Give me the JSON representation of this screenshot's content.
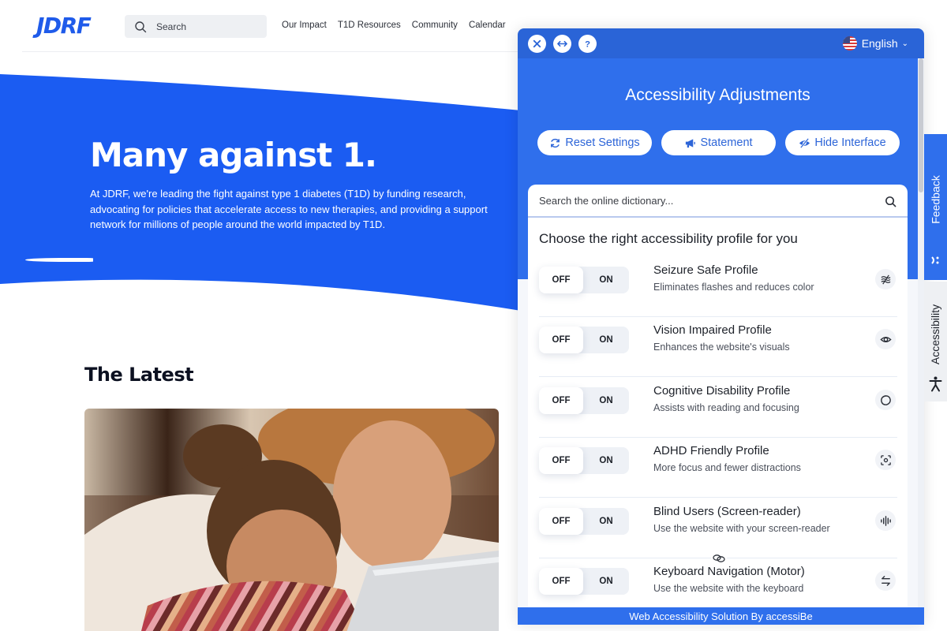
{
  "site": {
    "logo": "JDRF",
    "search_placeholder": "Search",
    "nav": [
      "Our Impact",
      "T1D Resources",
      "Community",
      "Calendar"
    ]
  },
  "hero": {
    "title": "Many against 1.",
    "text": "At JDRF, we're leading the fight against type 1 diabetes (T1D) by funding research, advocating for policies that accelerate access to new therapies, and providing a support network for millions of people around the world impacted by T1D.",
    "color": "#1b5cf2"
  },
  "latest": {
    "title": "The Latest",
    "image_alt": "Mother and young daughter looking at a laptop"
  },
  "panel": {
    "top_icons": [
      "close-icon",
      "resize-icon",
      "help-icon"
    ],
    "language": "English",
    "title": "Accessibility Adjustments",
    "buttons": [
      {
        "label": "Reset Settings",
        "icon": "refresh-icon"
      },
      {
        "label": "Statement",
        "icon": "megaphone-icon"
      },
      {
        "label": "Hide Interface",
        "icon": "eye-slash-icon"
      }
    ],
    "dictionary_placeholder": "Search the online dictionary...",
    "section_title": "Choose the right accessibility profile for you",
    "toggle_off": "OFF",
    "toggle_on": "ON",
    "profiles": [
      {
        "name": "Seizure Safe Profile",
        "desc": "Eliminates flashes and reduces color",
        "icon": "waves-slash-icon",
        "state": "OFF"
      },
      {
        "name": "Vision Impaired Profile",
        "desc": "Enhances the website's visuals",
        "icon": "eye-icon",
        "state": "OFF"
      },
      {
        "name": "Cognitive Disability Profile",
        "desc": "Assists with reading and focusing",
        "icon": "circle-icon",
        "state": "OFF"
      },
      {
        "name": "ADHD Friendly Profile",
        "desc": "More focus and fewer distractions",
        "icon": "focus-frame-icon",
        "state": "OFF"
      },
      {
        "name": "Blind Users (Screen-reader)",
        "desc": "Use the website with your screen-reader",
        "icon": "audio-wave-icon",
        "state": "OFF"
      },
      {
        "name": "Keyboard Navigation (Motor)",
        "desc": "Use the website with the keyboard",
        "icon": "arrows-swap-icon",
        "state": "OFF"
      }
    ],
    "footer": "Web Accessibility Solution By accessiBe",
    "colors": {
      "header": "#2a64d7",
      "body": "#2f6fec",
      "button_text": "#2d65d8"
    }
  },
  "side_tabs": {
    "feedback": "Feedback",
    "accessibility": "Accessibility"
  }
}
